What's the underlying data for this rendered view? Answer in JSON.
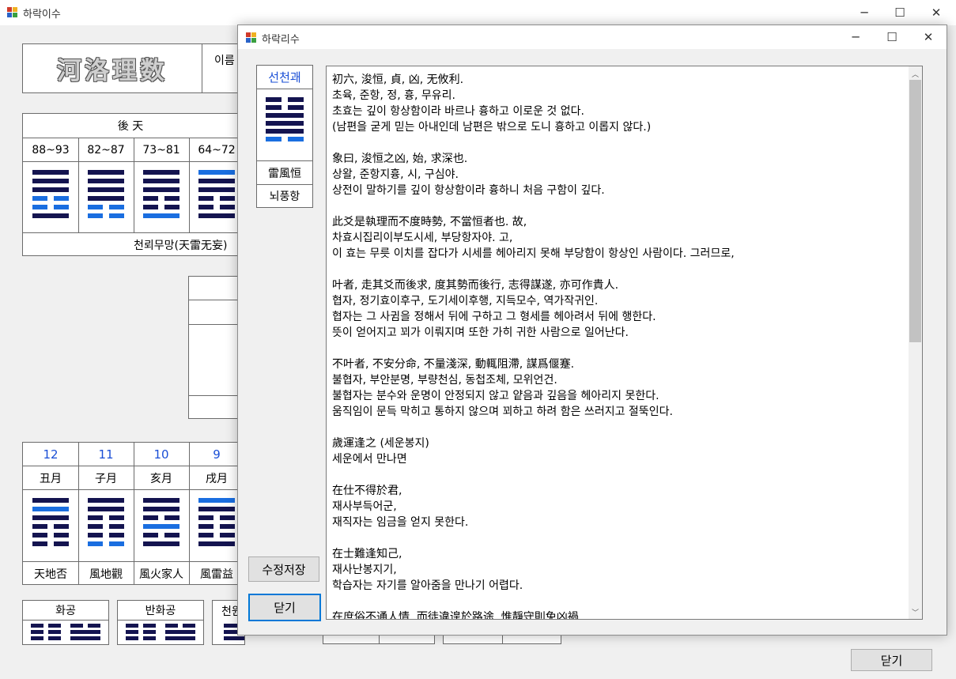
{
  "main_window": {
    "title": "하락이수",
    "min_glyph": "─",
    "max_glyph": "☐",
    "close_glyph": "✕"
  },
  "logo": {
    "text": "河洛理数"
  },
  "name_label": "이름",
  "later_heaven": {
    "title": "後 天",
    "ranges": [
      "88~93",
      "82~87",
      "73~81",
      "64~72"
    ],
    "name": "천뢰무망(天雷无妄)"
  },
  "months": {
    "numbers": [
      "12",
      "11",
      "10",
      "9"
    ],
    "branches": [
      "丑月",
      "子月",
      "亥月",
      "戌月"
    ],
    "names": [
      "天地否",
      "風地觀",
      "風火家人",
      "風雷益"
    ]
  },
  "bottom_boxes": {
    "labels": [
      "화공",
      "반화공",
      "천원"
    ]
  },
  "close_main_label": "닫기",
  "dialog": {
    "title": "하락리수",
    "min_glyph": "─",
    "max_glyph": "☐",
    "close_glyph": "✕",
    "side": {
      "header": "선천괘",
      "hanja": "雷風恒",
      "korean": "뇌풍항"
    },
    "save_label": "수정저장",
    "close_label": "닫기",
    "lines": [
      "初六, 浚恒, 貞, 凶, 无攸利.",
      "초육, 준항, 정, 흉, 무유리.",
      "초효는 깊이 항상함이라 바르나 흉하고 이로운 것 없다.",
      "(남편을 굳게 믿는 아내인데 남편은 밖으로 도니 흉하고 이롭지 않다.)",
      "",
      "象曰, 浚恒之凶, 始, 求深也.",
      "상왈, 준항지흉, 시, 구심야.",
      "상전이 말하기를 깊이 항상함이라 흉하니 처음 구함이 깊다.",
      "",
      "此爻是執理而不度時勢, 不當恒者也. 故,",
      "차효시집리이부도시세, 부당항자야. 고,",
      "이 효는 무릇 이치를 잡다가 시세를 헤아리지 못해 부당함이 항상인 사람이다. 그러므로,",
      "",
      "叶者, 走其爻而後求, 度其勢而後行, 志得謀遂, 亦可作貴人.",
      "협자, 정기효이후구, 도기세이후행, 지득모수, 역가작귀인.",
      "협자는 그 사귐을 정해서 뒤에 구하고 그 형세를 헤아려서 뒤에 행한다.",
      "뜻이 얻어지고 꾀가 이뤄지며 또한 가히 귀한 사람으로 일어난다.",
      "",
      "不叶者, 不安分命, 不量淺深, 動輒阻滯, 謀爲偃蹇.",
      "불협자, 부안분명, 부량천심, 동첩조체, 모위언건.",
      "불협자는 분수와 운명이 안정되지 않고 얕음과 깊음을 헤아리지 못한다.",
      "움직임이 문득 막히고 통하지 않으며 꾀하고 하려 함은 쓰러지고 절뚝인다.",
      "",
      "歲運逢之 (세운봉지)",
      "세운에서 만나면",
      "",
      "在仕不得於君,",
      "재사부득어군,",
      "재직자는 임금을 얻지 못한다.",
      "",
      "在士難逢知己,",
      "재사난봉지기,",
      "학습자는 자기를 알아줌을 만나기 어렵다.",
      "",
      "在庶俗不通人情, 而徒違遑於路途, 惟靜守則免凶禍."
    ]
  },
  "colors": {
    "dark_bar": "#141450",
    "accent_bar": "#1a6ee0",
    "blue_text": "#1a4fd6",
    "window_bg": "#f0f0f0",
    "dialog_border": "#0078d7"
  }
}
